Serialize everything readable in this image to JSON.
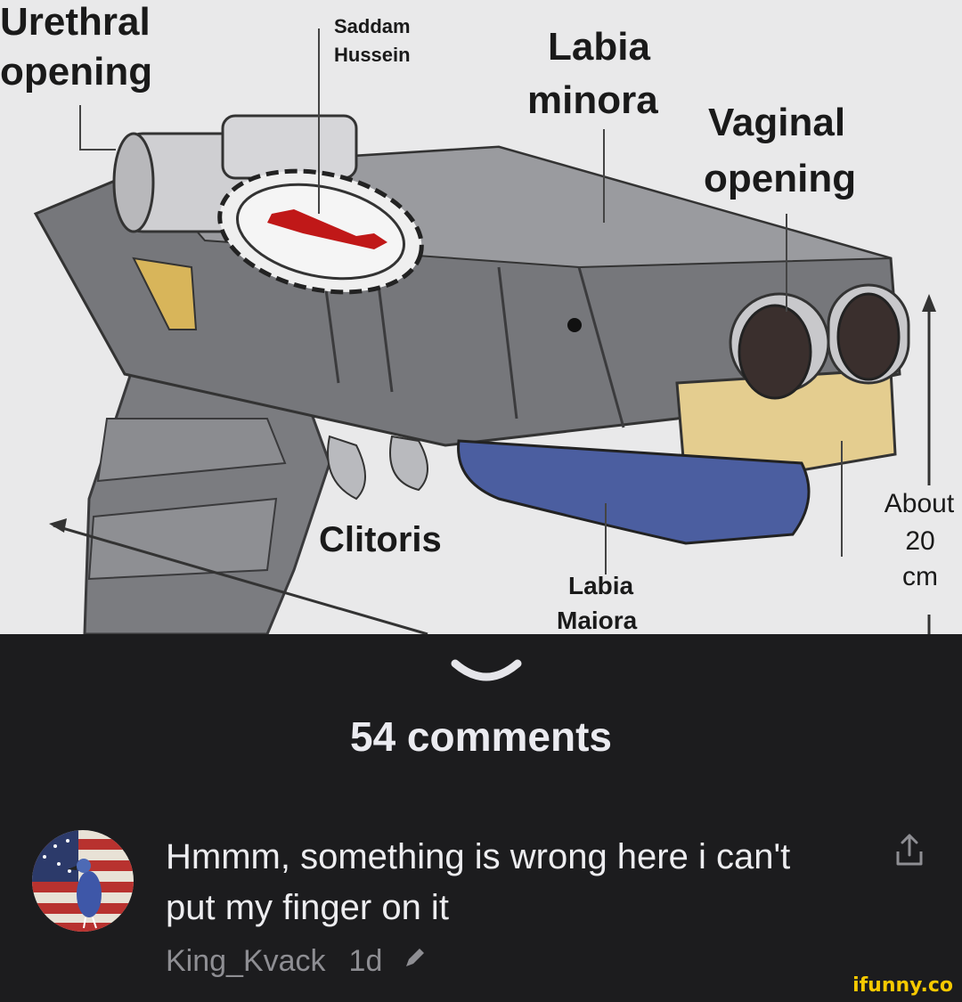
{
  "meme": {
    "labels": {
      "urethral_line1": "Urethral",
      "urethral_line2": "opening",
      "saddam_line1": "Saddam",
      "saddam_line2": "Hussein",
      "labia_minora_line1": "Labia",
      "labia_minora_line2": "minora",
      "vaginal_line1": "Vaginal",
      "vaginal_line2": "opening",
      "clitoris": "Clitoris",
      "labia_maiora_line1": "Labia",
      "labia_maiora_line2": "Maiora",
      "size_line1": "About",
      "size_line2": "20",
      "size_line3": "cm"
    }
  },
  "comments": {
    "count_label": "54 comments",
    "expand_icon": "chevron-down-icon"
  },
  "comment": {
    "text": "Hmmm, something is wrong here i can't put my finger on it",
    "author": "King_Kvack",
    "time": "1d",
    "avatar_icon": "flag-duck-avatar",
    "share_icon": "share-icon",
    "edit_icon": "pencil-icon"
  },
  "watermark": "ifunny.co",
  "colors": {
    "background": "#1c1c1e",
    "text": "#ededf0",
    "muted": "#8e8e93",
    "watermark": "#f7c900"
  }
}
